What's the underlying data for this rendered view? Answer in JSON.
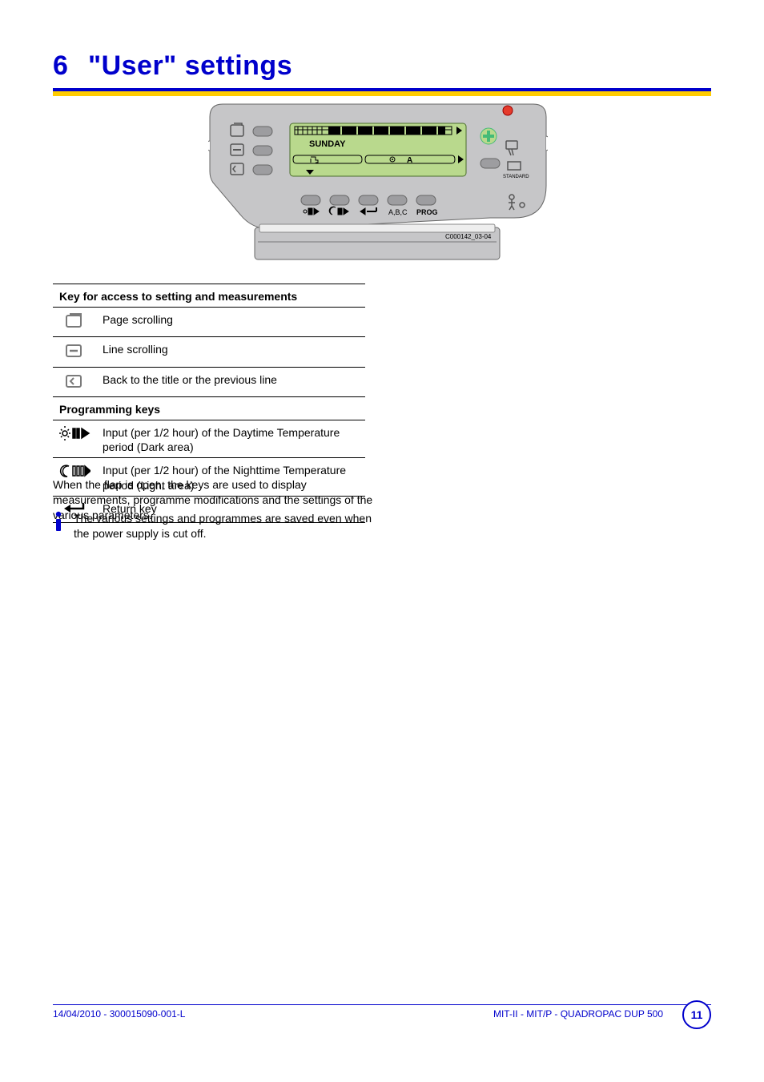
{
  "heading": {
    "number": "6",
    "title": "\"User\" settings"
  },
  "device": {
    "display_text": "SUNDAY",
    "display_badge": "A",
    "standard_label": "STANDARD",
    "bottom_labels": [
      "A,B,C",
      "PROG"
    ],
    "caption": "C000142_03-04"
  },
  "key_table": {
    "header1": "Key for access to setting and measurements",
    "rows1": [
      {
        "icon": "page-scroll-icon",
        "desc": "Page scrolling"
      },
      {
        "icon": "line-scroll-icon",
        "desc": "Line scrolling"
      },
      {
        "icon": "back-title-icon",
        "desc": "Back to the title or the previous line"
      }
    ],
    "header2": "Programming keys",
    "rows2": [
      {
        "icon": "day-temp-icon",
        "desc": "Input (per 1/2 hour) of the Daytime Temperature period (Dark area)"
      },
      {
        "icon": "night-temp-icon",
        "desc": "Input (per 1/2 hour) of the Nighttime Temperature period (Light area)"
      },
      {
        "icon": "return-icon",
        "desc": "Return key"
      }
    ]
  },
  "body_para": "When the flap is open, the keys are used to display measurements, programme modifications and the settings of the various parameters.",
  "info_note": "The various settings and programmes are saved even when the power supply is cut off.",
  "footer": {
    "left": "14/04/2010 - 300015090-001-L",
    "right": "MIT-II - MIT/P - QUADROPAC DUP 500",
    "page_number": "11"
  }
}
